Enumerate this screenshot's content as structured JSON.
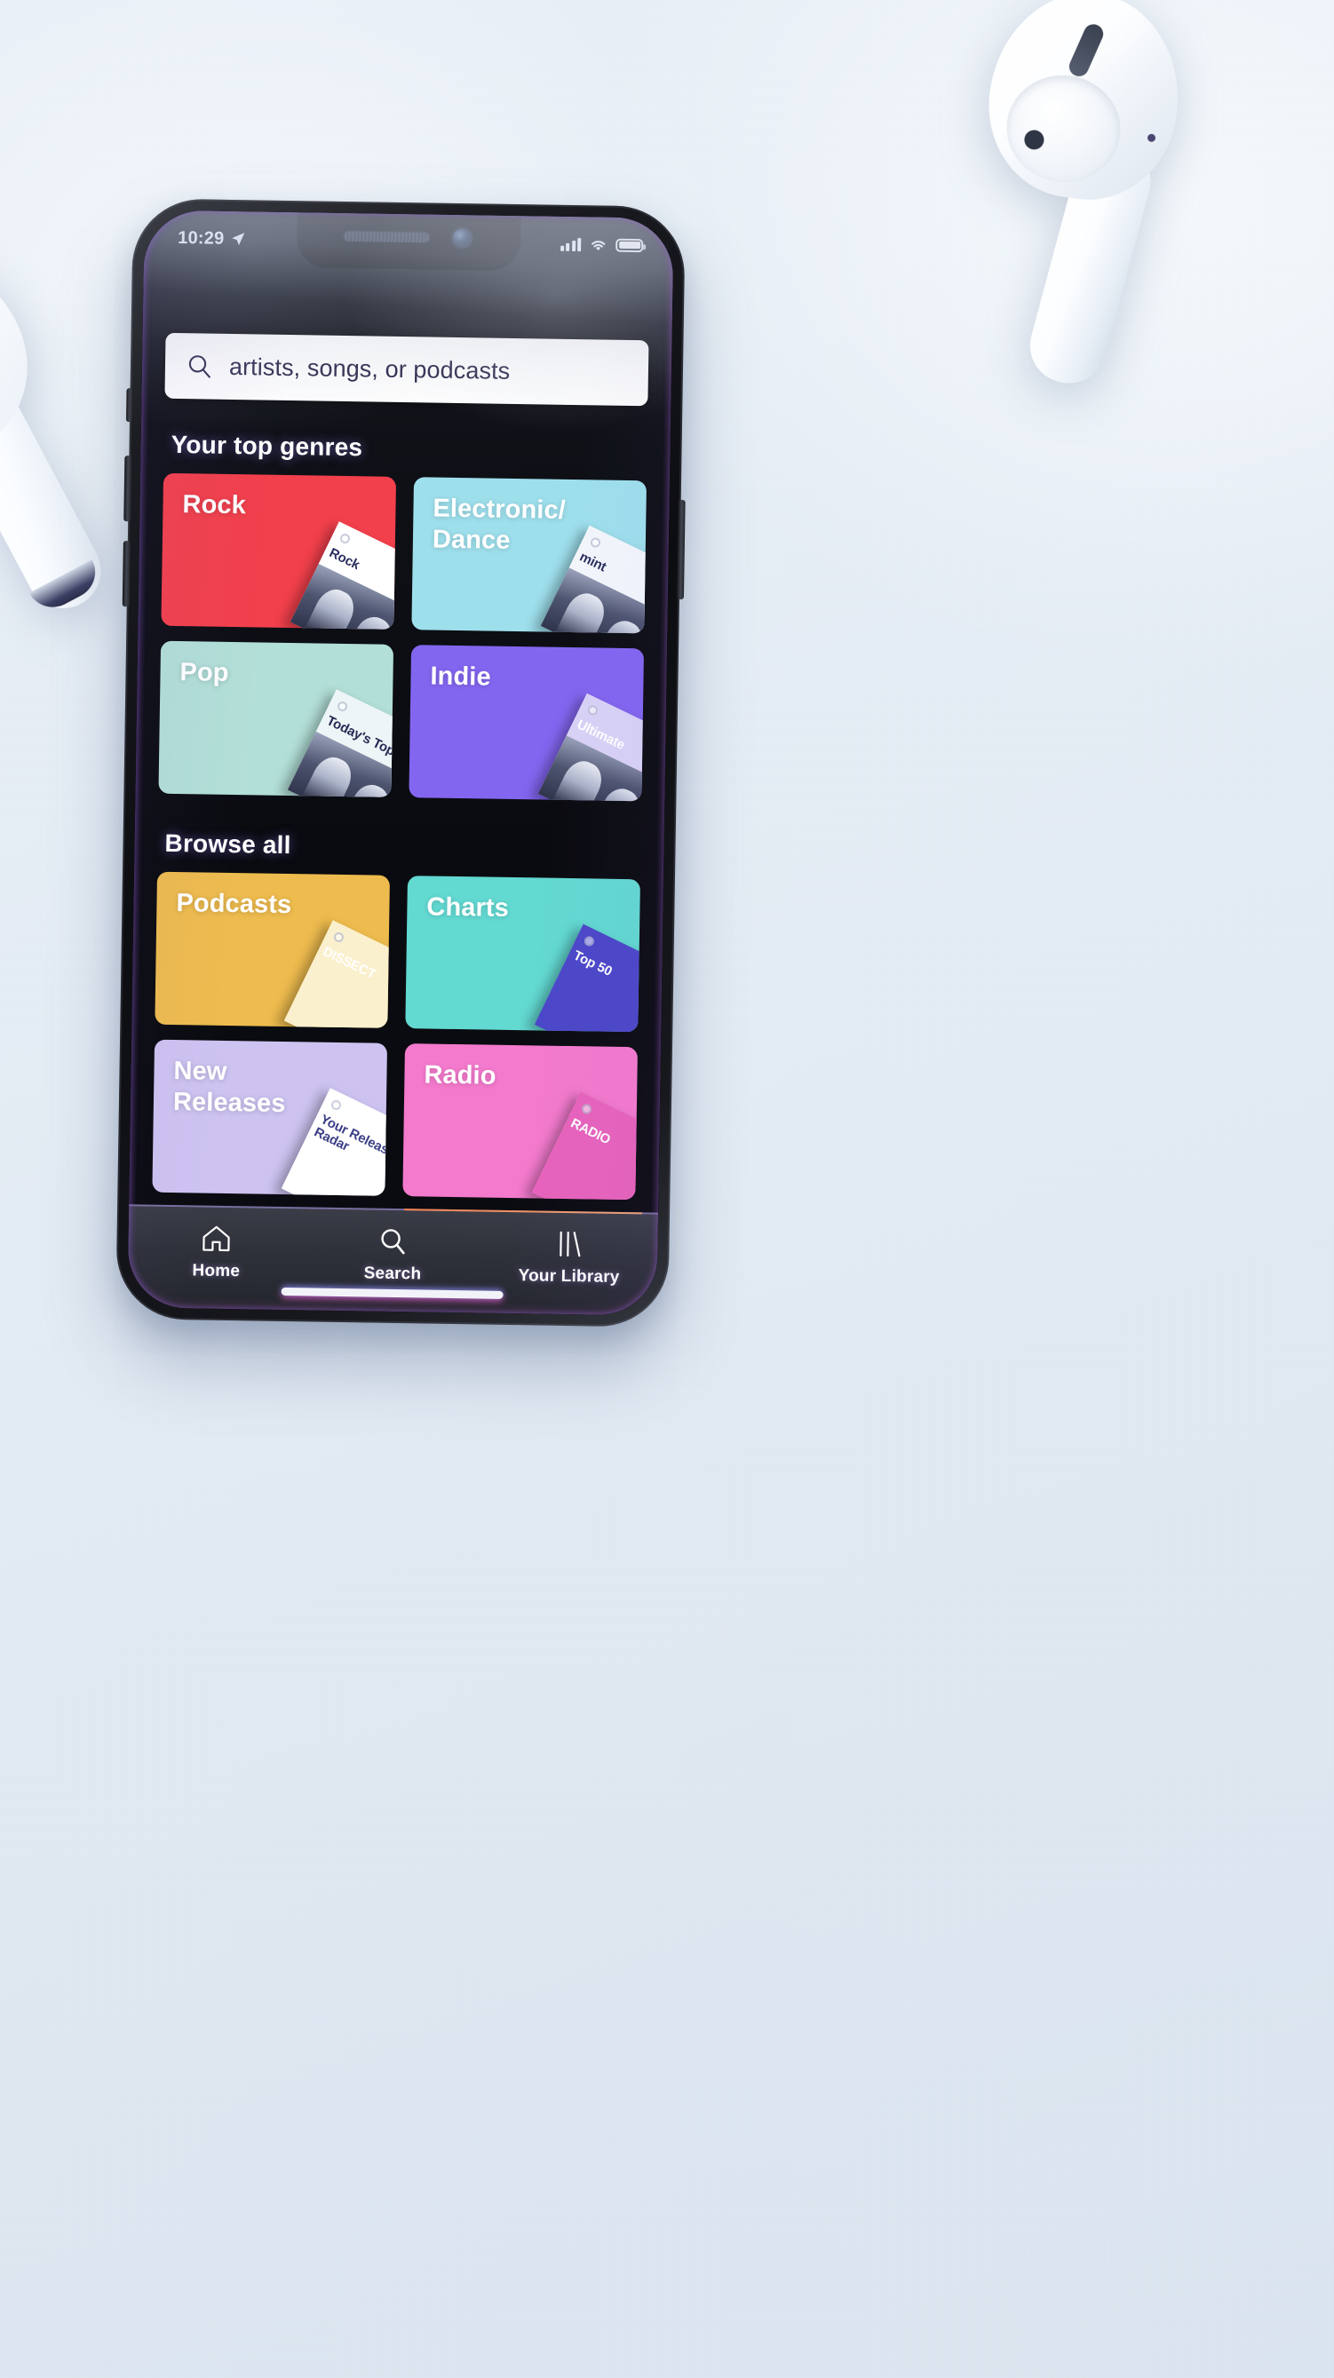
{
  "device": {
    "status_bar": {
      "time": "10:29",
      "location_icon": "location-arrow-icon",
      "cellular_icon": "cellular-signal-icon",
      "wifi_icon": "wifi-icon",
      "battery_icon": "battery-full-icon"
    }
  },
  "app": {
    "search": {
      "icon": "search-icon",
      "value": "",
      "placeholder": "artists, songs, or podcasts"
    },
    "sections": [
      {
        "title": "Your top genres",
        "cards": [
          {
            "label": "Rock",
            "color": "#F2404C",
            "thumb_bg": "#ffffff",
            "thumb_text": "Rock",
            "thumb_text_color": "#2b2f5e"
          },
          {
            "label": "Electronic/\nDance",
            "color": "#9EDFEC",
            "thumb_bg": "#f2f6fb",
            "thumb_text": "mint",
            "thumb_text_color": "#2b2f5e"
          },
          {
            "label": "Pop",
            "color": "#B2DFD7",
            "thumb_bg": "#eef5f6",
            "thumb_text": "Today's Top H",
            "thumb_text_color": "#262a55"
          },
          {
            "label": "Indie",
            "color": "#8366F0",
            "thumb_bg": "#d8d2f6",
            "thumb_text": "Ultimate",
            "thumb_text_color": "#ffffff"
          }
        ]
      },
      {
        "title": "Browse all",
        "cards": [
          {
            "label": "Podcasts",
            "color": "#EDBB4E",
            "thumb_bg": "#fbf0cd",
            "thumb_text": "DISSECT",
            "thumb_text_color": "#ffffff"
          },
          {
            "label": "Charts",
            "color": "#62D9D1",
            "thumb_bg": "#4b47c8",
            "thumb_text": "Top 50",
            "thumb_text_color": "#ffffff"
          },
          {
            "label": "New\nReleases",
            "color": "#CDC2F0",
            "thumb_bg": "#ffffff",
            "thumb_text": "Your Release Radar",
            "thumb_text_color": "#3b3f86"
          },
          {
            "label": "Radio",
            "color": "#F47ACD",
            "thumb_bg": "#e863bb",
            "thumb_text": "RADIO",
            "thumb_text_color": "#ffffff"
          }
        ]
      }
    ],
    "tabs": [
      {
        "label": "Home",
        "icon": "home-icon",
        "active": false
      },
      {
        "label": "Search",
        "icon": "search-icon",
        "active": true
      },
      {
        "label": "Your Library",
        "icon": "library-icon",
        "active": false
      }
    ]
  }
}
